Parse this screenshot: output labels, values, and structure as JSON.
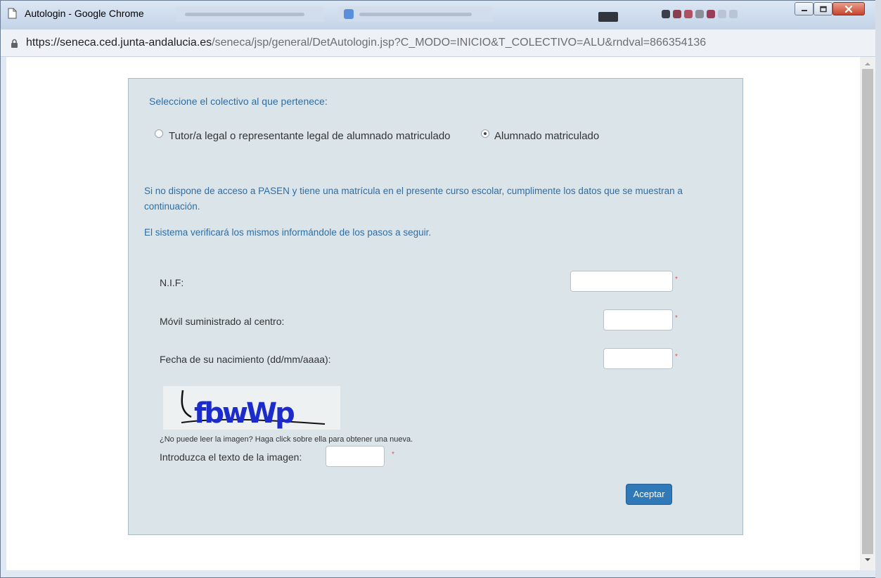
{
  "window": {
    "title": "Autologin - Google Chrome",
    "controls": [
      "minimize",
      "maximize",
      "close"
    ]
  },
  "address_bar": {
    "url_host": "https://seneca.ced.junta-andalucia.es",
    "url_path": "/seneca/jsp/general/DetAutologin.jsp?C_MODO=INICIO&T_COLECTIVO=ALU&rndval=866354136"
  },
  "form": {
    "heading": "Seleccione el colectivo al que pertenece:",
    "radio_options": [
      {
        "label": "Tutor/a legal o representante legal de alumnado matriculado",
        "checked": false
      },
      {
        "label": "Alumnado matriculado",
        "checked": true
      }
    ],
    "info_text_1": "Si no dispone de acceso a PASEN y tiene una matrícula en el presente curso escolar, cumplimente los datos que se muestran a continuación.",
    "info_text_2": "El sistema verificará los mismos informándole de los pasos a seguir.",
    "fields": [
      {
        "label": "N.I.F:",
        "value": "",
        "required": true
      },
      {
        "label": "Móvil suministrado al centro:",
        "value": "",
        "required": true
      },
      {
        "label": "Fecha de su nacimiento (dd/mm/aaaa):",
        "value": "",
        "required": true
      }
    ],
    "required_mark": "*",
    "captcha_text": "fbwWp",
    "captcha_hint": "¿No puede leer la imagen? Haga click sobre ella para obtener una nueva.",
    "captcha_label": "Introduzca el texto de la imagen:",
    "captcha_value": "",
    "submit_label": "Aceptar"
  },
  "colors": {
    "accent_blue": "#2e6da4",
    "button_blue": "#2f79b9",
    "panel_bg": "#dbe5e9",
    "required_red": "#e05050"
  }
}
